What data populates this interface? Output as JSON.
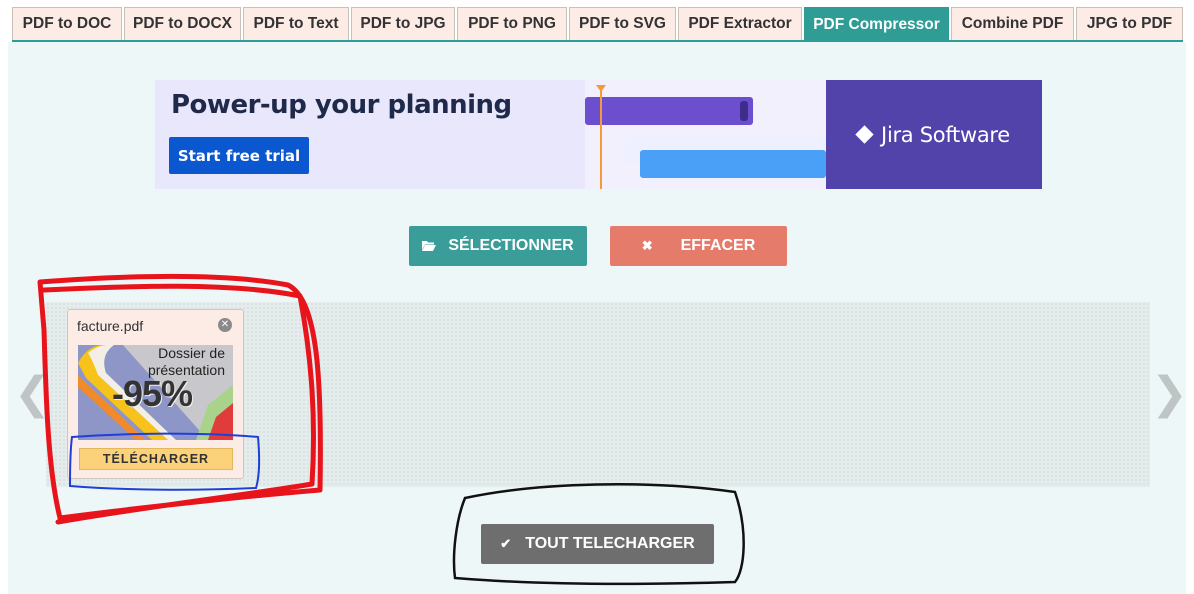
{
  "tabs": [
    {
      "label": "PDF to DOC",
      "active": false
    },
    {
      "label": "PDF to DOCX",
      "active": false
    },
    {
      "label": "PDF to Text",
      "active": false
    },
    {
      "label": "PDF to JPG",
      "active": false
    },
    {
      "label": "PDF to PNG",
      "active": false
    },
    {
      "label": "PDF to SVG",
      "active": false
    },
    {
      "label": "PDF Extractor",
      "active": false
    },
    {
      "label": "PDF Compressor",
      "active": true
    },
    {
      "label": "Combine PDF",
      "active": false
    },
    {
      "label": "JPG to PDF",
      "active": false
    }
  ],
  "ad": {
    "headline": "Power-up your planning",
    "cta": "Start free trial",
    "brand": "Jira Software"
  },
  "actions": {
    "select_label": "SÉLECTIONNER",
    "select_icon": "folder-open-icon",
    "clear_label": "EFFACER",
    "clear_icon": "x-icon"
  },
  "files": [
    {
      "name": "facture.pdf",
      "thumbnail_title": "Dossier de présentation",
      "compression": "-95%",
      "download_label": "TÉLÉCHARGER"
    }
  ],
  "download_all": {
    "label": "TOUT TELECHARGER",
    "icon": "check-icon"
  },
  "colors": {
    "accent": "#2f9c96",
    "tab_bg": "#fdece6",
    "select_button": "#3a9d9a",
    "clear_button": "#e57c6b",
    "download_button": "#fbd27a",
    "download_all_button": "#6e6e6e",
    "annotation_red": "#e8141c",
    "annotation_blue": "#1f3fd6",
    "annotation_black": "#111111"
  }
}
